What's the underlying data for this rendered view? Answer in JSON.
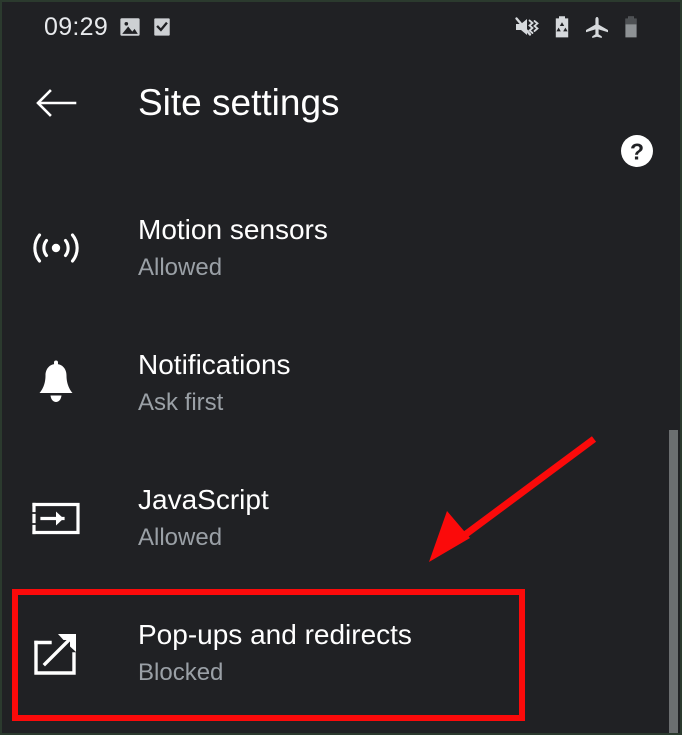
{
  "statusbar": {
    "time": "09:29",
    "left_icons": [
      {
        "name": "image-icon",
        "label": "image"
      },
      {
        "name": "checkbox-checked-icon",
        "label": "checkbox"
      }
    ],
    "right_icons": [
      {
        "name": "volume-mute-vibrate-icon",
        "label": "mute"
      },
      {
        "name": "battery-saver-icon",
        "label": "battery saver"
      },
      {
        "name": "airplane-mode-icon",
        "label": "airplane mode"
      },
      {
        "name": "battery-icon",
        "label": "battery"
      }
    ]
  },
  "toolbar": {
    "back_label": "Back",
    "title": "Site settings",
    "help_label": "Help"
  },
  "settings": {
    "items": [
      {
        "icon": "motion-sensors-icon",
        "title": "Motion sensors",
        "status": "Allowed"
      },
      {
        "icon": "notifications-bell-icon",
        "title": "Notifications",
        "status": "Ask first"
      },
      {
        "icon": "javascript-code-icon",
        "title": "JavaScript",
        "status": "Allowed"
      },
      {
        "icon": "popups-redirects-external-link-icon",
        "title": "Pop-ups and redirects",
        "status": "Blocked"
      }
    ]
  },
  "annotations": {
    "arrow_color": "#fb0a0a",
    "highlight_color": "#fb0a0a",
    "arrow_target_item": "Pop-ups and redirects"
  },
  "colors": {
    "background": "#202124",
    "primary_text": "#ffffff",
    "secondary_text": "#9aa0a6",
    "scrollbar": "#6b6e70",
    "annotation_red": "#fb0a0a"
  }
}
